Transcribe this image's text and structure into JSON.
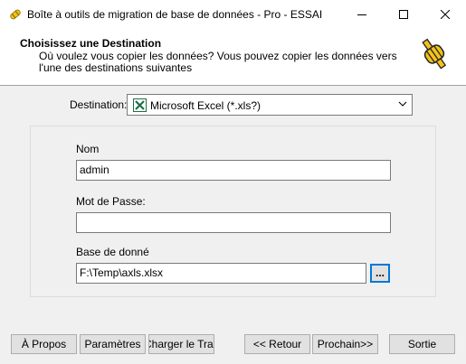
{
  "window": {
    "title": "Boîte à outils de migration de base de données - Pro - ESSAI",
    "icons": [
      "app-icon",
      "minimize-icon",
      "maximize-icon",
      "close-icon"
    ]
  },
  "header": {
    "title": "Choisissez une Destination",
    "subtitle": "Où voulez vous copier les données? Vous pouvez copier les données vers l'une des destinations suivantes",
    "icon": "database-plug-icon"
  },
  "destination": {
    "label": "Destination:",
    "selected": "Microsoft Excel (*.xls?)",
    "icon": "excel-icon"
  },
  "form": {
    "name_label": "Nom",
    "name_value": "admin",
    "password_label": "Mot de Passe:",
    "password_value": "",
    "db_label": "Base de donné",
    "db_value": "F:\\Temp\\axls.xlsx",
    "browse_label": "..."
  },
  "buttons": {
    "about": "À Propos",
    "params": "Paramètres",
    "load": "Charger le Travail",
    "back": "<< Retour",
    "next": "Prochain>>",
    "exit": "Sortie"
  }
}
